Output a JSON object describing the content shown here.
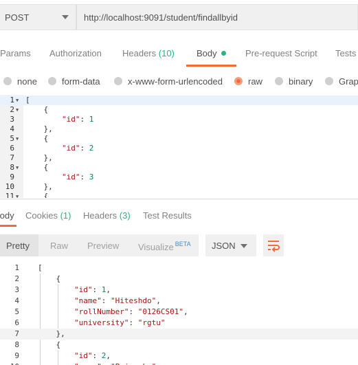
{
  "request": {
    "method": "POST",
    "url": "http://localhost:9091/student/findallbyid"
  },
  "request_tabs": [
    {
      "label": "Params"
    },
    {
      "label": "Authorization"
    },
    {
      "label": "Headers",
      "count": "(10)"
    },
    {
      "label": "Body"
    },
    {
      "label": "Pre-request Script"
    },
    {
      "label": "Tests"
    }
  ],
  "body_types": [
    "none",
    "form-data",
    "x-www-form-urlencoded",
    "raw",
    "binary",
    "GraphQL"
  ],
  "selected_body_type": "raw",
  "request_body": {
    "lines": [
      {
        "n": "1",
        "text": "["
      },
      {
        "n": "2",
        "text": "    {"
      },
      {
        "n": "3",
        "text": "        \"id\": 1"
      },
      {
        "n": "4",
        "text": "    },"
      },
      {
        "n": "5",
        "text": "    {"
      },
      {
        "n": "6",
        "text": "        \"id\": 2"
      },
      {
        "n": "7",
        "text": "    },"
      },
      {
        "n": "8",
        "text": "    {"
      },
      {
        "n": "9",
        "text": "        \"id\": 3"
      },
      {
        "n": "10",
        "text": "    },"
      },
      {
        "n": "11",
        "text": "    {"
      }
    ]
  },
  "response_tabs": [
    {
      "label": "Body"
    },
    {
      "label": "Cookies",
      "count": "(1)"
    },
    {
      "label": "Headers",
      "count": "(3)"
    },
    {
      "label": "Test Results"
    }
  ],
  "response_view": {
    "modes": [
      "Pretty",
      "Raw",
      "Preview",
      "Visualize"
    ],
    "beta": "BETA",
    "format": "JSON"
  },
  "response_body": {
    "lines": [
      {
        "n": "1",
        "text": "["
      },
      {
        "n": "2",
        "text": "    {"
      },
      {
        "n": "3",
        "text": "        \"id\": 1,"
      },
      {
        "n": "4",
        "text": "        \"name\": \"Hiteshdo\","
      },
      {
        "n": "5",
        "text": "        \"rollNumber\": \"0126CS01\","
      },
      {
        "n": "6",
        "text": "        \"university\": \"rgtu\""
      },
      {
        "n": "7",
        "text": "    },"
      },
      {
        "n": "8",
        "text": "    {"
      },
      {
        "n": "9",
        "text": "        \"id\": 2,"
      },
      {
        "n": "10",
        "text": "        \"name\": \"Priyanka\","
      }
    ]
  },
  "colors": {
    "accent": "#f26b3a",
    "count_green": "#26b47f",
    "json_key": "#a31515",
    "json_number": "#098658"
  }
}
